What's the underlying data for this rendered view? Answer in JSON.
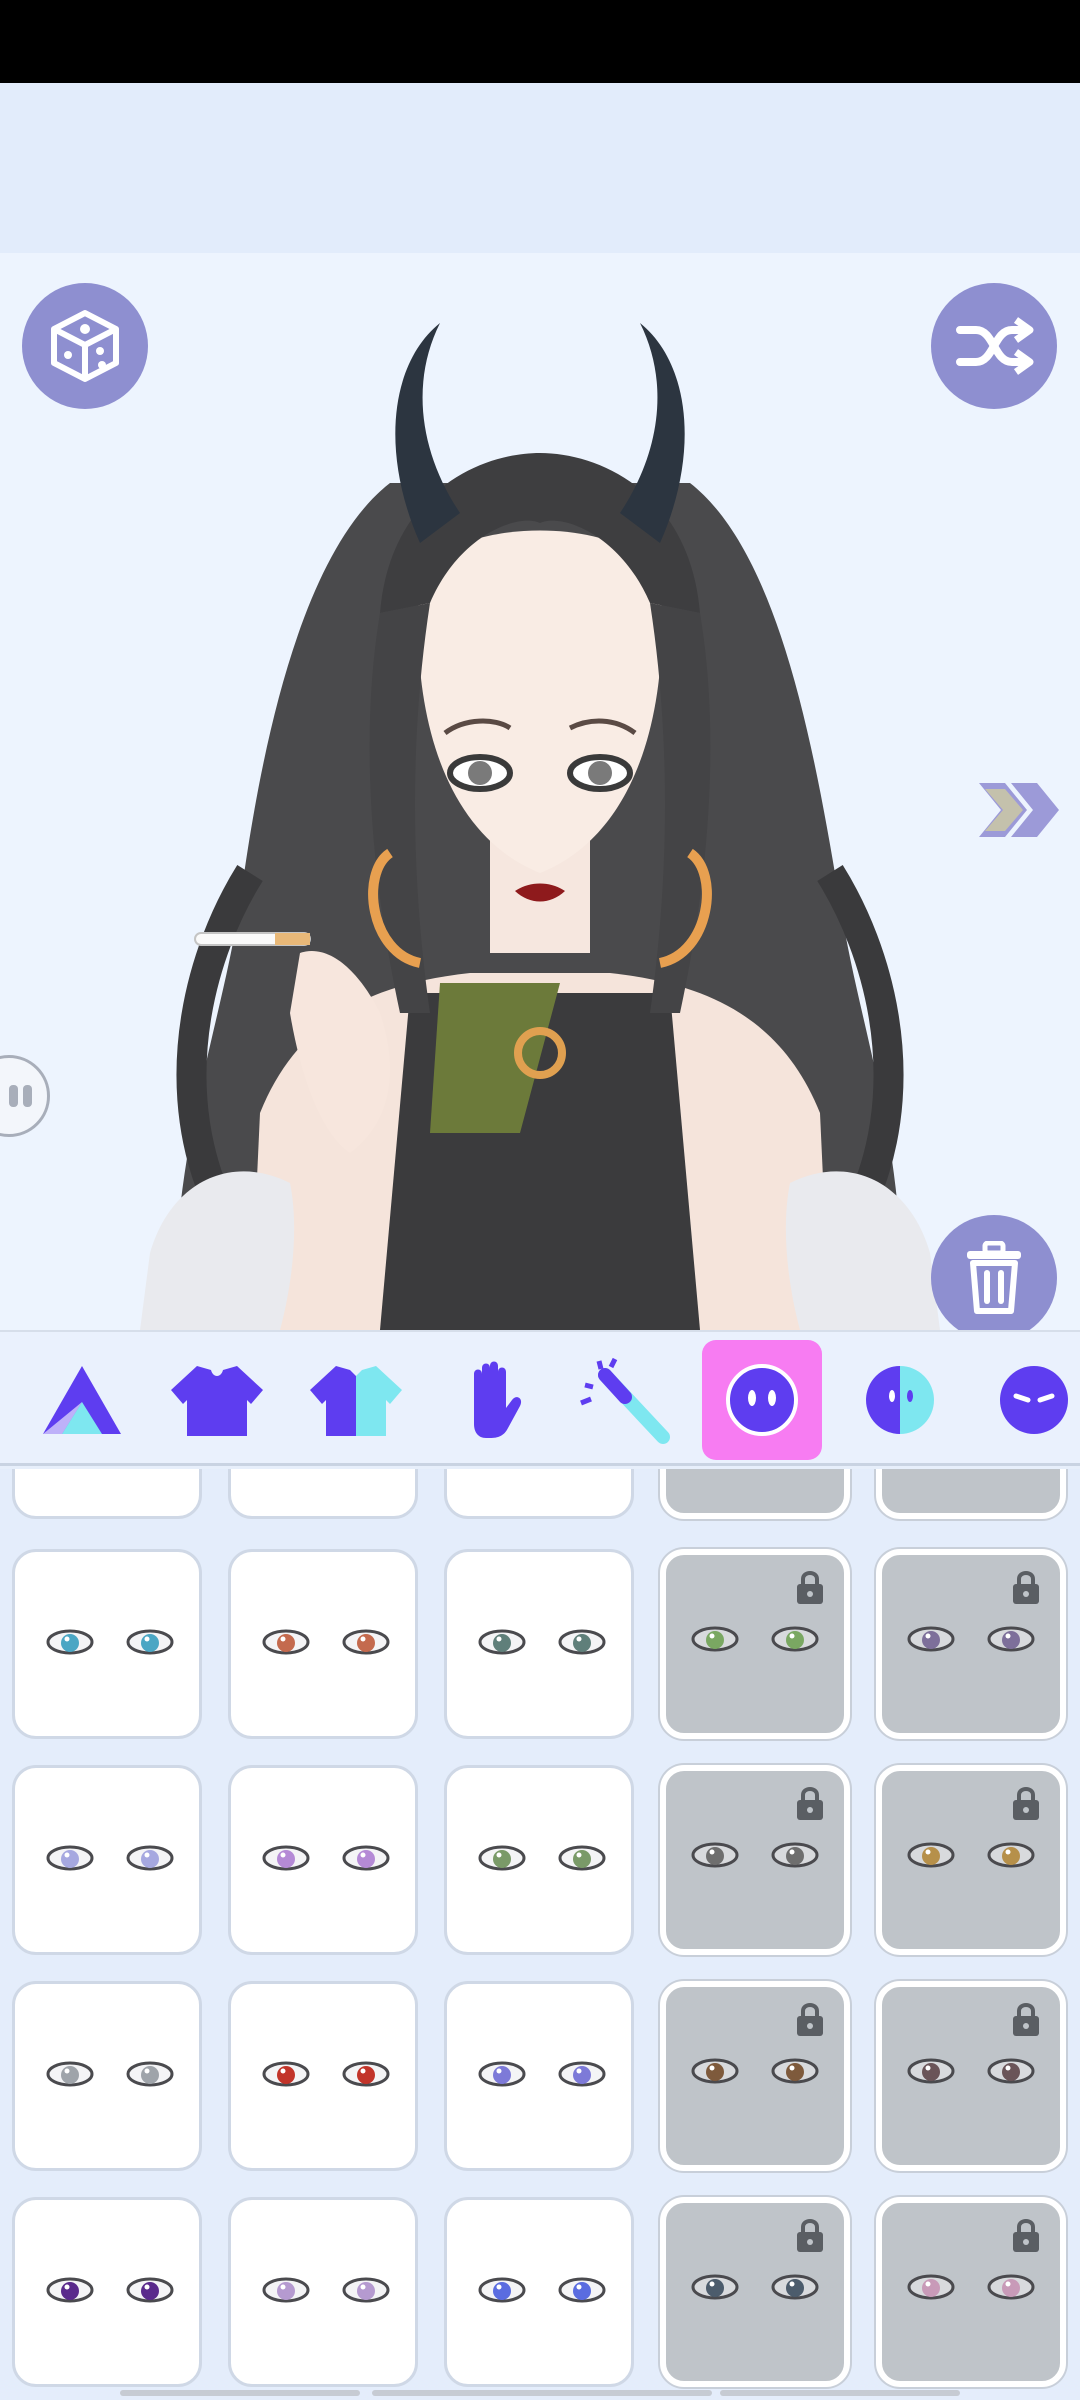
{
  "colors": {
    "accent": "#8e8fd0",
    "category_active": "#f77cf2",
    "category_icon": "#5e3df0",
    "category_icon_light": "#7ee7f0",
    "chevron": "#d6d29a",
    "locked_tile": "#bfc4c9"
  },
  "toolbar": {
    "dice_icon": "dice-icon",
    "shuffle_icon": "shuffle-icon",
    "trash_icon": "trash-icon",
    "next_icon": "double-chevron-right-icon"
  },
  "categories": [
    {
      "id": "shapes",
      "icon": "shapes-icon",
      "active": false
    },
    {
      "id": "top",
      "icon": "sweater-icon",
      "active": false
    },
    {
      "id": "dress",
      "icon": "two-tone-sweater-icon",
      "active": false
    },
    {
      "id": "hand",
      "icon": "hand-icon",
      "active": false
    },
    {
      "id": "wand",
      "icon": "magic-wand-icon",
      "active": false
    },
    {
      "id": "eyes",
      "icon": "face-eyes-icon",
      "active": true
    },
    {
      "id": "face-half",
      "icon": "half-face-icon",
      "active": false
    },
    {
      "id": "brows",
      "icon": "face-brows-icon",
      "active": false
    }
  ],
  "eye_options": [
    {
      "row": 1,
      "col": 1,
      "iris": "#4aa6c4",
      "locked": false
    },
    {
      "row": 1,
      "col": 2,
      "iris": "#c46a4e",
      "locked": false
    },
    {
      "row": 1,
      "col": 3,
      "iris": "#5f7f7a",
      "locked": false
    },
    {
      "row": 1,
      "col": 4,
      "iris": "#7aa862",
      "locked": true
    },
    {
      "row": 1,
      "col": 5,
      "iris": "#7d6f9a",
      "locked": true
    },
    {
      "row": 2,
      "col": 1,
      "iris": "#a6a8e0",
      "locked": false
    },
    {
      "row": 2,
      "col": 2,
      "iris": "#b58ad6",
      "locked": false
    },
    {
      "row": 2,
      "col": 3,
      "iris": "#7a9a68",
      "locked": false
    },
    {
      "row": 2,
      "col": 4,
      "iris": "#6e6e6e",
      "locked": true
    },
    {
      "row": 2,
      "col": 5,
      "iris": "#b6904a",
      "locked": true
    },
    {
      "row": 3,
      "col": 1,
      "iris": "#9fa4aa",
      "locked": false
    },
    {
      "row": 3,
      "col": 2,
      "iris": "#c2342a",
      "locked": false
    },
    {
      "row": 3,
      "col": 3,
      "iris": "#7d7ad8",
      "locked": false
    },
    {
      "row": 3,
      "col": 4,
      "iris": "#7e5a3c",
      "locked": true
    },
    {
      "row": 3,
      "col": 5,
      "iris": "#6a5458",
      "locked": true
    },
    {
      "row": 4,
      "col": 1,
      "iris": "#5a2a8c",
      "locked": false
    },
    {
      "row": 4,
      "col": 2,
      "iris": "#b59ad0",
      "locked": false
    },
    {
      "row": 4,
      "col": 3,
      "iris": "#5a6ce0",
      "locked": false
    },
    {
      "row": 4,
      "col": 4,
      "iris": "#4c5c6c",
      "locked": true
    },
    {
      "row": 4,
      "col": 5,
      "iris": "#c89ab8",
      "locked": true
    }
  ]
}
